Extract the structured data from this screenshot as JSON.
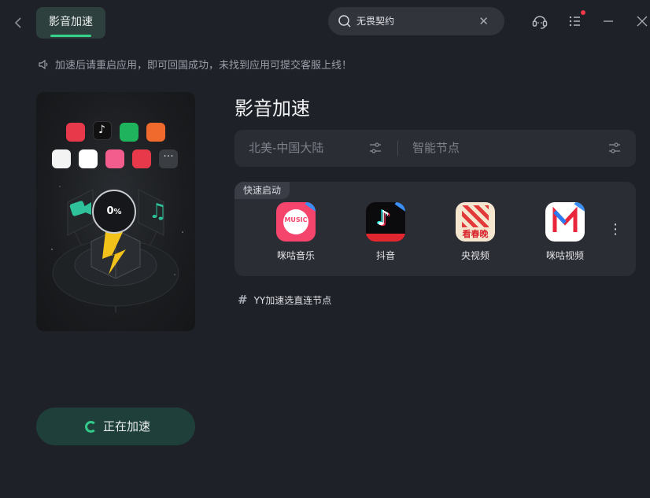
{
  "titlebar": {
    "tab_label": "影音加速",
    "search_value": "无畏契约",
    "icons": [
      "back-icon",
      "search-icon",
      "clear-icon",
      "support-icon",
      "menu-icon",
      "minimize-icon",
      "close-icon"
    ]
  },
  "notice": {
    "text": "加速后请重启应用，即可回国成功，未找到应用可提交客服上线！"
  },
  "preview": {
    "progress_value": "0",
    "progress_unit": "%",
    "progress_percent": 0
  },
  "accelerate_button": {
    "label": "正在加速"
  },
  "main": {
    "title": "影音加速",
    "node_region": "北美-中国大陆",
    "node_smart": "智能节点"
  },
  "quick_launch": {
    "tag": "快速启动",
    "apps": [
      {
        "name": "咪咕音乐",
        "icon_text": "MUSIC"
      },
      {
        "name": "抖音",
        "icon_text": ""
      },
      {
        "name": "央视频",
        "icon_text": "看春晚"
      },
      {
        "name": "咪咕视频",
        "icon_text": ""
      }
    ]
  },
  "yy_node": {
    "text": "YY加速选直连节点"
  },
  "colors": {
    "background": "#1f2128",
    "panel": "#2b2d34",
    "accent_green": "#35d28a",
    "tab_bg": "#2e403d",
    "button_bg": "#1f3f3a"
  }
}
